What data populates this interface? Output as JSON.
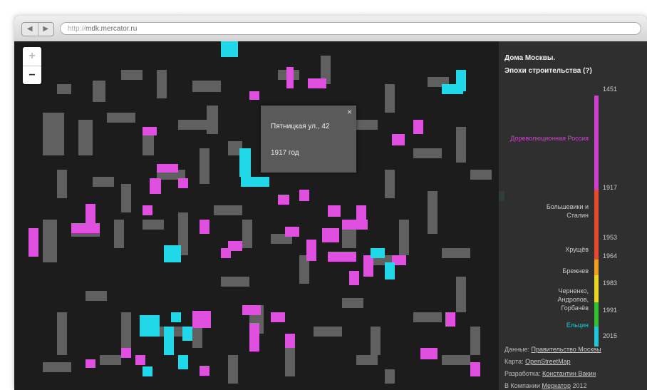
{
  "browser": {
    "url_protocol": "http://",
    "url_host": "mdk.mercator.ru",
    "back_icon": "chevron-left-icon",
    "forward_icon": "chevron-right-icon"
  },
  "map": {
    "zoom_in": "+",
    "zoom_out": "−",
    "colors": {
      "background": "#1c1c1c",
      "old_building": "#777777",
      "pre_revolution": "#e050e0",
      "modern": "#20d8e8"
    }
  },
  "popup": {
    "close": "×",
    "address": "Пятницкая ул., 42",
    "year": "1917 год"
  },
  "legend": {
    "title": "Дома Москвы.",
    "subtitle": "Эпохи строительства (?)",
    "eras": [
      {
        "label": "Дореволюционная Россия",
        "color": "#d040d0"
      },
      {
        "label": "Большевики и Сталин",
        "color": "#e84830"
      },
      {
        "label": "Хрущёв",
        "color": "#f0a020"
      },
      {
        "label": "Брежнев",
        "color": "#e8d820"
      },
      {
        "label": "Черненко, Андропов, Горбачёв",
        "color": "#30c030"
      },
      {
        "label": "Ельцин",
        "color": "#20c8d8"
      }
    ],
    "ticks": [
      "1451",
      "1917",
      "1953",
      "1964",
      "1983",
      "1991",
      "2015"
    ]
  },
  "credits": {
    "data_label": "Данные:",
    "data_link": "Правительство Москвы",
    "map_label": "Карта:",
    "map_link": "OpenStreetMap",
    "dev_label": "Разработка:",
    "dev_link": "Константин Вакин",
    "company_label": "В Компании",
    "company_link": "Меркатор",
    "year": "2012"
  }
}
